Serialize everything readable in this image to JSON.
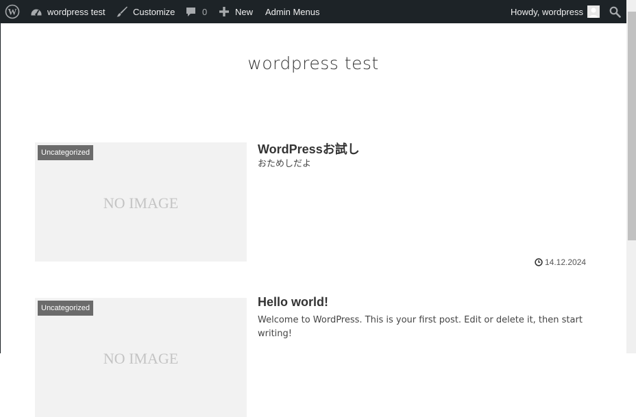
{
  "admin_bar": {
    "site_name": "wordpress test",
    "customize_label": "Customize",
    "comments_count": "0",
    "new_label": "New",
    "admin_menus_label": "Admin Menus",
    "howdy_label": "Howdy, wordpress"
  },
  "site": {
    "title": "wordpress test"
  },
  "posts": [
    {
      "category": "Uncategorized",
      "thumbnail_text": "NO IMAGE",
      "title": "WordPressお試し",
      "excerpt": "おためしだよ",
      "date": "14.12.2024"
    },
    {
      "category": "Uncategorized",
      "thumbnail_text": "NO IMAGE",
      "title": "Hello world!",
      "excerpt": "Welcome to WordPress. This is your first post. Edit or delete it, then start writing!"
    }
  ],
  "colors": {
    "admin_bar_bg": "#1d2327",
    "category_badge_bg": "#6b6b6b",
    "thumbnail_bg": "#f2f2f2"
  }
}
